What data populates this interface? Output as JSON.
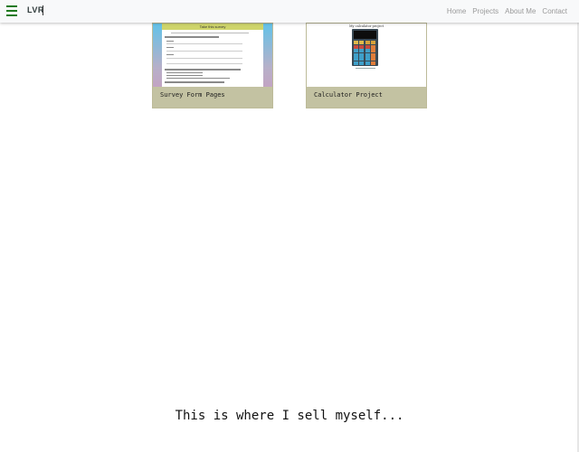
{
  "navbar": {
    "brand": "LVR",
    "links": [
      "Home",
      "Projects",
      "About Me",
      "Contact"
    ]
  },
  "projects": [
    {
      "title": "Survey Form Pages",
      "thumbnail_heading": "Take this survey"
    },
    {
      "title": "Calculator Project",
      "thumbnail_heading": "My calculator project"
    }
  ],
  "tagline": "This is where I sell myself...",
  "colors": {
    "navbar_bg": "#f8f9fa",
    "hamburger": "#1f7a1f",
    "card_footer": "#c3c2a2",
    "nav_link": "#9a9a9a"
  },
  "icons": {
    "menu": "hamburger-icon"
  }
}
